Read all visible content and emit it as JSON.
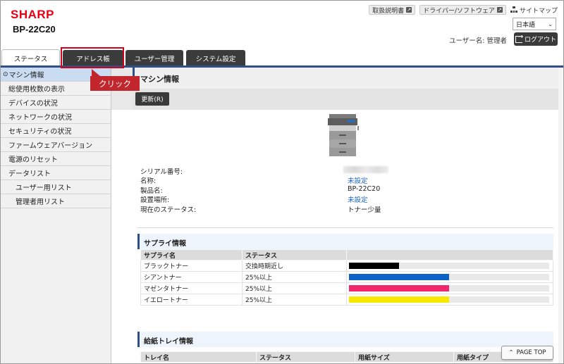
{
  "header": {
    "logo": "SHARP",
    "model": "BP-22C20",
    "links": [
      "取扱説明書",
      "ドライバー/ソフトウェア"
    ],
    "sitemap": "サイトマップ",
    "language": "日本語",
    "user_label": "ユーザー名: 管理者",
    "logout": "ログアウト"
  },
  "tabs": [
    "ステータス",
    "アドレス帳",
    "ユーザー管理",
    "システム設定"
  ],
  "annotation": {
    "label": "クリック",
    "color": "#c1272d"
  },
  "sidebar": {
    "items": [
      {
        "label": "マシン情報",
        "active": true
      },
      {
        "label": "総使用枚数の表示"
      },
      {
        "label": "デバイスの状況"
      },
      {
        "label": "ネットワークの状況"
      },
      {
        "label": "セキュリティの状況"
      },
      {
        "label": "ファームウェアバージョン"
      },
      {
        "label": "電源のリセット"
      },
      {
        "label": "データリスト"
      },
      {
        "label": "ユーザー用リスト",
        "sub": true
      },
      {
        "label": "管理者用リスト",
        "sub": true
      }
    ]
  },
  "main": {
    "title": "マシン情報",
    "refresh": "更新(R)",
    "info": {
      "labels": [
        "シリアル番号:",
        "名称:",
        "製品名:",
        "設置場所:",
        "現在のステータス:"
      ],
      "name": "未設定",
      "product": "BP-22C20",
      "location": "未設定",
      "status": "トナー少量"
    },
    "supply": {
      "title": "サプライ情報",
      "headers": [
        "サプライ名",
        "ステータス"
      ],
      "rows": [
        {
          "name": "ブラックトナー",
          "status": "交換時期近し",
          "level": 0.25,
          "color": "#000000"
        },
        {
          "name": "シアントナー",
          "status": "25%以上",
          "level": 0.5,
          "color": "#0b63c8"
        },
        {
          "name": "マゼンタトナー",
          "status": "25%以上",
          "level": 0.5,
          "color": "#f0286b"
        },
        {
          "name": "イエロートナー",
          "status": "25%以上",
          "level": 0.5,
          "color": "#f8e800"
        }
      ]
    },
    "tray": {
      "title": "給紙トレイ情報",
      "headers": [
        "トレイ名",
        "ステータス",
        "用紙サイズ",
        "用紙タイプ"
      ]
    }
  },
  "page_top": "PAGE TOP"
}
